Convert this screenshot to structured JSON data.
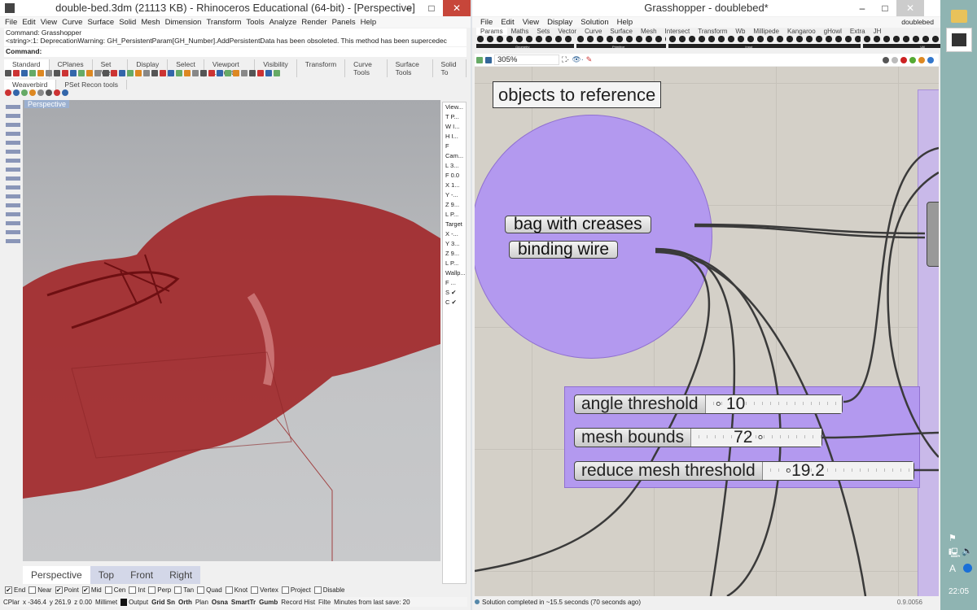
{
  "rhino": {
    "title": "double-bed.3dm (21113 KB) - Rhinoceros Educational (64-bit) - [Perspective]",
    "menu": [
      "File",
      "Edit",
      "View",
      "Curve",
      "Surface",
      "Solid",
      "Mesh",
      "Dimension",
      "Transform",
      "Tools",
      "Analyze",
      "Render",
      "Panels",
      "Help"
    ],
    "history": [
      "Command: Grasshopper",
      "<string>:1: DeprecationWarning: GH_PersistentParam[GH_Number].AddPersistentData has been obsoleted.  This method has been supercedec"
    ],
    "command_label": "Command:",
    "toolbar_tabs": [
      "Standard",
      "CPlanes",
      "Set View",
      "Display",
      "Select",
      "Viewport Layout",
      "Visibility",
      "Transform",
      "Curve Tools",
      "Surface Tools",
      "Solid To"
    ],
    "plugin_tabs": [
      "Weaverbird",
      "PSet Recon tools"
    ],
    "viewport_label": "Perspective",
    "viewport_tabs": [
      "Perspective",
      "Top",
      "Front",
      "Right"
    ],
    "panel": [
      "View...",
      "T P...",
      "W I...",
      "H I...",
      "F",
      "Cam...",
      "L 3...",
      "F 0.0",
      "X 1...",
      "Y -...",
      "Z 9...",
      "L P...",
      "Target",
      "X -...",
      "Y 3...",
      "Z 9...",
      "L P...",
      "Wallp...",
      "F ...",
      "S ✔",
      "C ✔"
    ],
    "osnaps": [
      {
        "label": "End",
        "on": true
      },
      {
        "label": "Near",
        "on": false
      },
      {
        "label": "Point",
        "on": true
      },
      {
        "label": "Mid",
        "on": true
      },
      {
        "label": "Cen",
        "on": false
      },
      {
        "label": "Int",
        "on": false
      },
      {
        "label": "Perp",
        "on": false
      },
      {
        "label": "Tan",
        "on": false
      },
      {
        "label": "Quad",
        "on": false
      },
      {
        "label": "Knot",
        "on": false
      },
      {
        "label": "Vertex",
        "on": false
      },
      {
        "label": "Project",
        "on": false
      },
      {
        "label": "Disable",
        "on": false
      }
    ],
    "status": [
      "CPlar",
      "x -346.4",
      "y 261.9",
      "z 0.00",
      "Millimet",
      "Output",
      "Grid Sn",
      "Orth",
      "Plan",
      "Osna",
      "SmartTr",
      "Gumb",
      "Record Hist",
      "Filte",
      "Minutes from last save: 20"
    ]
  },
  "gh": {
    "title": "Grasshopper - doublebed*",
    "menu": [
      "File",
      "Edit",
      "View",
      "Display",
      "Solution",
      "Help"
    ],
    "doc_name": "doublebed",
    "tabs": [
      "Params",
      "Maths",
      "Sets",
      "Vector",
      "Curve",
      "Surface",
      "Mesh",
      "Intersect",
      "Transform",
      "Wb",
      "Millipede",
      "Kangaroo",
      "gHowl",
      "Extra",
      "JH"
    ],
    "panels": [
      "Geometry",
      "Primitive",
      "Input",
      "Util"
    ],
    "zoom": "305%",
    "group_label": "objects to reference",
    "params": [
      "bag with creases",
      "binding wire"
    ],
    "sliders": [
      {
        "name": "angle threshold",
        "value": "10"
      },
      {
        "name": "mesh bounds",
        "value": "72"
      },
      {
        "name": "reduce mesh threshold",
        "value": "19.2"
      }
    ],
    "status": "Solution completed in ~15.5 seconds (70 seconds ago)",
    "version": "0.9.0056"
  },
  "taskbar": {
    "clock": "22:05",
    "ime": "A"
  }
}
